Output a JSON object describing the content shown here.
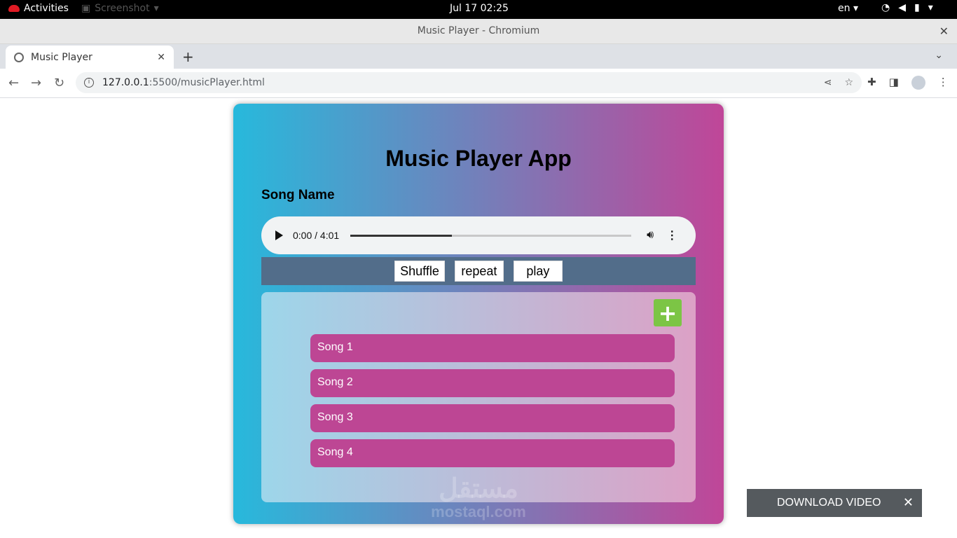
{
  "system": {
    "activities": "Activities",
    "app_menu": "Screenshot",
    "clock": "Jul 17  02:25",
    "lang": "en"
  },
  "window": {
    "title": "Music Player - Chromium"
  },
  "browser": {
    "tab_title": "Music Player",
    "url_host": "127.0.0.1",
    "url_path": ":5500/musicPlayer.html"
  },
  "page": {
    "title": "Music Player App",
    "song_name": "Song Name",
    "audio": {
      "time": "0:00 / 4:01",
      "progress": 0.36
    },
    "controls": {
      "shuffle": "Shuffle",
      "repeat": "repeat",
      "play": "play"
    },
    "add_label": "+",
    "songs": [
      "Song 1",
      "Song 2",
      "Song 3",
      "Song 4"
    ],
    "watermark": {
      "arabic": "مستقل",
      "latin": "mostaql.com"
    }
  },
  "download_bar": {
    "label": "DOWNLOAD VIDEO"
  }
}
